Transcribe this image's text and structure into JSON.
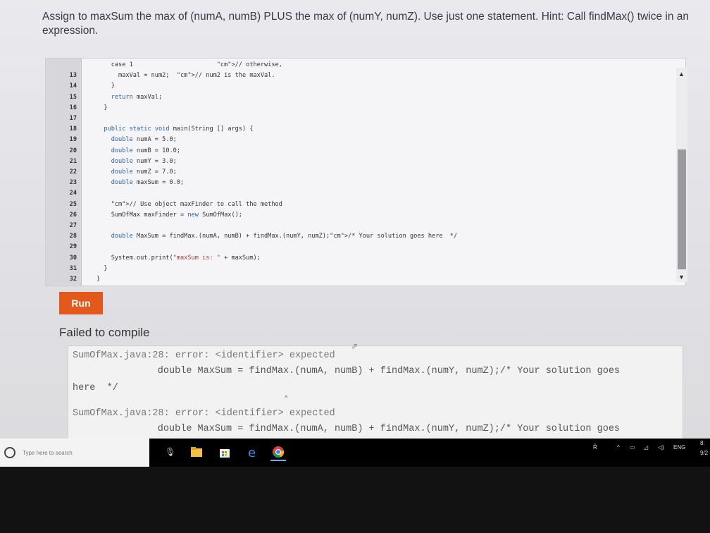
{
  "prompt": "Assign to maxSum the max of (numA, numB) PLUS the max of (numY, numZ). Use just one statement. Hint: Call findMax() twice in an expression.",
  "editor": {
    "lines": [
      {
        "num": "",
        "code": "    case 1                       // otherwise,"
      },
      {
        "num": "13",
        "code": "      maxVal = num2;  // num2 is the maxVal."
      },
      {
        "num": "14",
        "code": "    }"
      },
      {
        "num": "15",
        "code": "    return maxVal;"
      },
      {
        "num": "16",
        "code": "  }"
      },
      {
        "num": "17",
        "code": ""
      },
      {
        "num": "18",
        "code": "  public static void main(String [] args) {"
      },
      {
        "num": "19",
        "code": "    double numA = 5.0;"
      },
      {
        "num": "20",
        "code": "    double numB = 10.0;"
      },
      {
        "num": "21",
        "code": "    double numY = 3.0;"
      },
      {
        "num": "22",
        "code": "    double numZ = 7.0;"
      },
      {
        "num": "23",
        "code": "    double maxSum = 0.0;"
      },
      {
        "num": "24",
        "code": ""
      },
      {
        "num": "25",
        "code": "    // Use object maxFinder to call the method"
      },
      {
        "num": "26",
        "code": "    SumOfMax maxFinder = new SumOfMax();"
      },
      {
        "num": "27",
        "code": ""
      },
      {
        "num": "28",
        "code": "    double MaxSum = findMax.(numA, numB) + findMax.(numY, numZ);/* Your solution goes here  */"
      },
      {
        "num": "29",
        "code": ""
      },
      {
        "num": "30",
        "code": "    System.out.print(\"maxSum is: \" + maxSum);"
      },
      {
        "num": "31",
        "code": "  }"
      },
      {
        "num": "32",
        "code": "}"
      }
    ]
  },
  "run_label": "Run",
  "status": "Failed to compile",
  "console": {
    "lines": [
      "SumOfMax.java:28: error: <identifier> expected",
      "        double MaxSum = findMax.(numA, numB) + findMax.(numY, numZ);/* Your solution goes",
      "here  */",
      "",
      "SumOfMax.java:28: error: <identifier> expected",
      "        double MaxSum = findMax.(numA, numB) + findMax.(numY, numZ);/* Your solution goes"
    ]
  },
  "taskbar": {
    "search_placeholder": "Type here to search",
    "language": "ENG",
    "time": "8:",
    "date": "9/2"
  }
}
